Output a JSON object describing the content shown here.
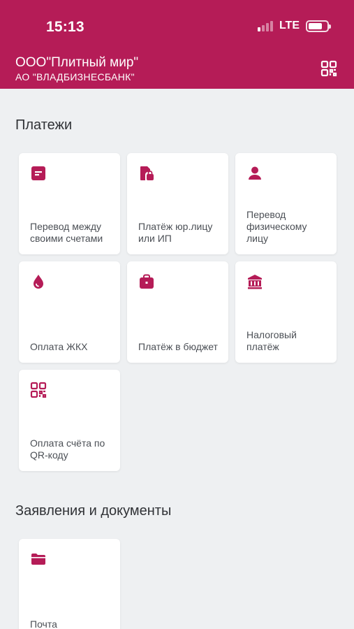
{
  "status_bar": {
    "time": "15:13",
    "network": "LTE",
    "signal_bars_active": 1,
    "battery_level": 0.75
  },
  "header": {
    "org_name": "ООО\"Плитный мир\"",
    "bank_name": "АО \"ВЛАДБИЗНЕСБАНК\"",
    "qr_icon": "qr-code-icon"
  },
  "colors": {
    "brand": "#b51c57",
    "background": "#eef0f2",
    "card": "#ffffff",
    "text": "#4b4f55"
  },
  "payments": {
    "title": "Платежи",
    "items": [
      {
        "label": "Перевод между своими счетами",
        "icon": "transfer-own-accounts-icon"
      },
      {
        "label": "Платёж юр.лицу или ИП",
        "icon": "legal-entity-payment-icon"
      },
      {
        "label": "Перевод физическому лицу",
        "icon": "person-icon"
      },
      {
        "label": "Оплата ЖКХ",
        "icon": "drop-icon"
      },
      {
        "label": "Платёж в бюджет",
        "icon": "briefcase-icon"
      },
      {
        "label": "Налоговый платёж",
        "icon": "bank-building-icon"
      },
      {
        "label": "Оплата счёта по QR-коду",
        "icon": "qr-code-icon"
      }
    ]
  },
  "documents": {
    "title": "Заявления и документы",
    "items": [
      {
        "label": "Почта",
        "icon": "folder-icon"
      }
    ]
  }
}
